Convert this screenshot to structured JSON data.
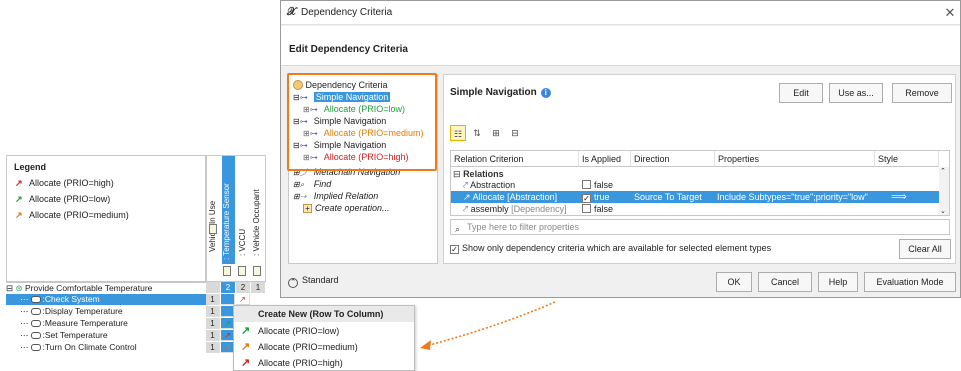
{
  "legend": {
    "title": "Legend",
    "items": [
      {
        "label": "Allocate (PRIO=high)",
        "arrow": "↗",
        "color": "#d62020"
      },
      {
        "label": "Allocate (PRIO=low)",
        "arrow": "↗",
        "color": "#1f9d3a"
      },
      {
        "label": "Allocate (PRIO=medium)",
        "arrow": "↗",
        "color": "#e07b00"
      }
    ]
  },
  "matrix": {
    "columns": [
      "Vehicle In Use",
      ": Temperature Sensor",
      ": VCCU",
      ": Vehicle Occupant"
    ],
    "counts": [
      "2",
      "2",
      "1"
    ],
    "root_row": "Provide Comfortable Temperature",
    "rows": [
      {
        "label": ":Check System",
        "count": "1"
      },
      {
        "label": ":Display Temperature",
        "count": "1"
      },
      {
        "label": ":Measure Temperature",
        "count": "1"
      },
      {
        "label": ":Set Temperature",
        "count": "1"
      },
      {
        "label": ":Turn On Climate Control",
        "count": "1"
      }
    ]
  },
  "popup": {
    "title": "Create New (Row To Column)",
    "items": [
      {
        "label": "Allocate (PRIO=low)",
        "color": "#1f9d3a"
      },
      {
        "label": "Allocate (PRIO=medium)",
        "color": "#e07b00"
      },
      {
        "label": "Allocate (PRIO=high)",
        "color": "#d62020"
      }
    ]
  },
  "dialog": {
    "title": "Dependency Criteria",
    "heading": "Edit Dependency Criteria",
    "close": "✕",
    "tree": {
      "root": "Dependency Criteria",
      "nodes": [
        {
          "label": "Simple Navigation"
        },
        {
          "label": "Allocate (PRIO=low)"
        },
        {
          "label": "Simple Navigation"
        },
        {
          "label": "Allocate (PRIO=medium)"
        },
        {
          "label": "Simple Navigation"
        },
        {
          "label": "Allocate (PRIO=high)"
        },
        {
          "label": "Metachain Navigation"
        },
        {
          "label": "Find"
        },
        {
          "label": "Implied Relation"
        },
        {
          "label": "Create operation..."
        }
      ]
    },
    "panel": {
      "title": "Simple Navigation",
      "buttons": {
        "edit": "Edit",
        "use_as": "Use as...",
        "remove": "Remove"
      },
      "table": {
        "headers": [
          "Relation Criterion",
          "Is Applied",
          "Direction",
          "Properties",
          "Style"
        ],
        "group": "Relations",
        "rows": [
          {
            "criterion": "Abstraction",
            "applied": "false",
            "checked": "",
            "direction": "",
            "properties": "",
            "style": ""
          },
          {
            "criterion": "Allocate [Abstraction]",
            "applied": "true",
            "checked": "✓",
            "direction": "Source To Target",
            "properties": "Include Subtypes=\"true\";priority=\"low\"",
            "style": "⟹"
          },
          {
            "criterion": "assembly",
            "suffix": "[Dependency]",
            "applied": "false",
            "checked": "",
            "direction": "",
            "properties": "",
            "style": ""
          }
        ]
      },
      "filter_placeholder": "Type here to filter properties",
      "show_only": "Show only dependency criteria which are available for selected element types",
      "clear_all": "Clear All"
    },
    "footer": {
      "standard": "Standard",
      "ok": "OK",
      "cancel": "Cancel",
      "help": "Help",
      "evaluation_mode": "Evaluation Mode"
    }
  }
}
